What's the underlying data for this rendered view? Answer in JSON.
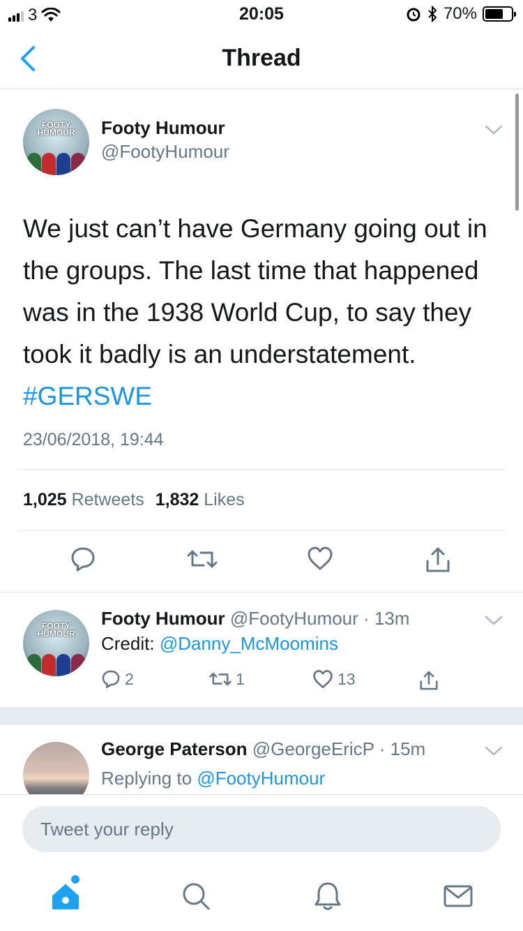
{
  "status_bar": {
    "carrier": "3",
    "time": "20:05",
    "battery": "70%",
    "battery_level": 0.7
  },
  "nav": {
    "title": "Thread",
    "back_icon": "chevron-left-icon"
  },
  "main_tweet": {
    "author_name": "Footy Humour",
    "author_handle": "@FootyHumour",
    "avatar_text": "FOOTY HUMOUR",
    "text": "We just can’t have Germany going out in the groups. The last time that happened was in the 1938 World Cup, to say they took it badly is an understatement.",
    "hashtag": "#GERSWE",
    "timestamp": "23/06/2018, 19:44",
    "retweet_count": "1,025",
    "retweet_label": "Retweets",
    "like_count": "1,832",
    "like_label": "Likes"
  },
  "reply1": {
    "author_name": "Footy Humour",
    "meta": "@FootyHumour · 13m",
    "text_prefix": "Credit: ",
    "mention": "@Danny_McMoomins",
    "reply_count": "2",
    "retweet_count": "1",
    "like_count": "13"
  },
  "reply2": {
    "author_name": "George Paterson",
    "meta": "@GeorgeEricP · 15m",
    "replying_prefix": "Replying to ",
    "replying_to": "@FootyHumour"
  },
  "reply_box": {
    "placeholder": "Tweet your reply"
  },
  "tabs": [
    "home-icon",
    "search-icon",
    "bell-icon",
    "mail-icon"
  ],
  "colors": {
    "accent": "#1da1f2",
    "link": "#1b95e0",
    "secondary_text": "#657786",
    "divider": "#e1e8ed"
  }
}
